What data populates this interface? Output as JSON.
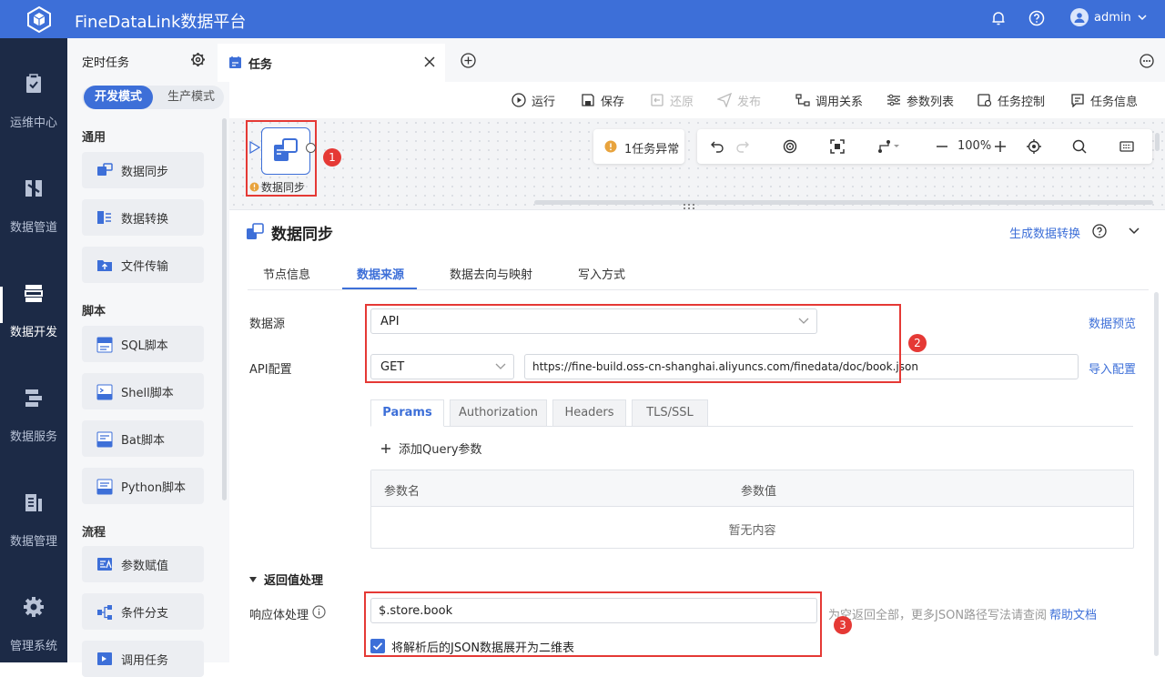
{
  "app": {
    "title": "FineDataLink数据平台",
    "user": "admin"
  },
  "nav": [
    {
      "label": "运维中心",
      "icon": "clipboard-check-icon",
      "active": false
    },
    {
      "label": "数据管道",
      "icon": "pipeline-icon",
      "active": false
    },
    {
      "label": "数据开发",
      "icon": "dev-stack-icon",
      "active": true
    },
    {
      "label": "数据服务",
      "icon": "service-icon",
      "active": false
    },
    {
      "label": "数据管理",
      "icon": "chart-bars-icon",
      "active": false
    },
    {
      "label": "管理系统",
      "icon": "gear-icon",
      "active": false
    }
  ],
  "panel": {
    "title": "定时任务",
    "mode_on": "开发模式",
    "mode_off": "生产模式",
    "sections": {
      "general": "通用",
      "script": "脚本",
      "flow": "流程"
    },
    "items": [
      "数据同步",
      "数据转换",
      "文件传输",
      "SQL脚本",
      "Shell脚本",
      "Bat脚本",
      "Python脚本",
      "参数赋值",
      "条件分支",
      "调用任务"
    ]
  },
  "tab": {
    "label": "任务"
  },
  "toolbar": {
    "run": "运行",
    "save": "保存",
    "restore": "还原",
    "publish": "发布",
    "relations": "调用关系",
    "params": "参数列表",
    "control": "任务控制",
    "info": "任务信息"
  },
  "canvas": {
    "node_label": "数据同步",
    "error_text": "1任务异常",
    "zoom": "100%",
    "badges": [
      "1",
      "2",
      "3"
    ]
  },
  "detail": {
    "title": "数据同步",
    "gen_link": "生成数据转换",
    "tabs": [
      "节点信息",
      "数据来源",
      "数据去向与映射",
      "写入方式"
    ],
    "source_label": "数据源",
    "source_value": "API",
    "preview_link": "数据预览",
    "api_label": "API配置",
    "method": "GET",
    "url": "https://fine-build.oss-cn-shanghai.aliyuncs.com/finedata/doc/book.json",
    "import_link": "导入配置",
    "param_tabs": [
      "Params",
      "Authorization",
      "Headers",
      "TLS/SSL"
    ],
    "add_query": "添加Query参数",
    "col_name": "参数名",
    "col_value": "参数值",
    "empty": "暂无内容",
    "return_section": "返回值处理",
    "response_label": "响应体处理",
    "response_value": "$.store.book",
    "hint": "为空返回全部，更多JSON路径写法请查阅",
    "help_link": "帮助文档",
    "checkbox_label": "将解析后的JSON数据展开为二维表"
  },
  "colors": {
    "primary": "#3d6fd8",
    "nav_bg": "#1c2a46",
    "annotation": "#e53935"
  }
}
